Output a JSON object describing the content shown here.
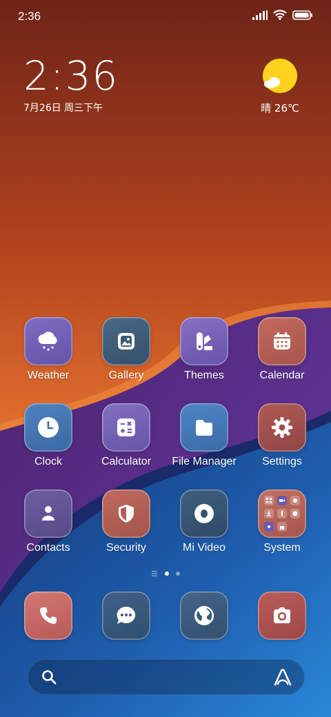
{
  "status_bar": {
    "time": "2:36"
  },
  "clock_widget": {
    "time": "2:36",
    "date": "7月26日 周三下午"
  },
  "weather_widget": {
    "text": "晴 26℃"
  },
  "apps": {
    "weather": "Weather",
    "gallery": "Gallery",
    "themes": "Themes",
    "calendar": "Calendar",
    "clock": "Clock",
    "calculator": "Calculator",
    "file_manager": "File Manager",
    "settings": "Settings",
    "contacts": "Contacts",
    "security": "Security",
    "mi_video": "Mi Video",
    "system": "System"
  },
  "page_indicator": {
    "pages": 2,
    "current": 1
  },
  "icons": {
    "status": [
      "signal-icon",
      "wifi-icon",
      "battery-icon"
    ],
    "dock": [
      "phone-icon",
      "messages-icon",
      "browser-icon",
      "camera-icon"
    ],
    "search": [
      "search-icon",
      "assistant-icon"
    ]
  },
  "colors": {
    "purple_tile": "#7560b0",
    "slate_tile": "#3c5c78",
    "red_tile": "#b55f55",
    "blue_tile": "#3f6fa6"
  }
}
